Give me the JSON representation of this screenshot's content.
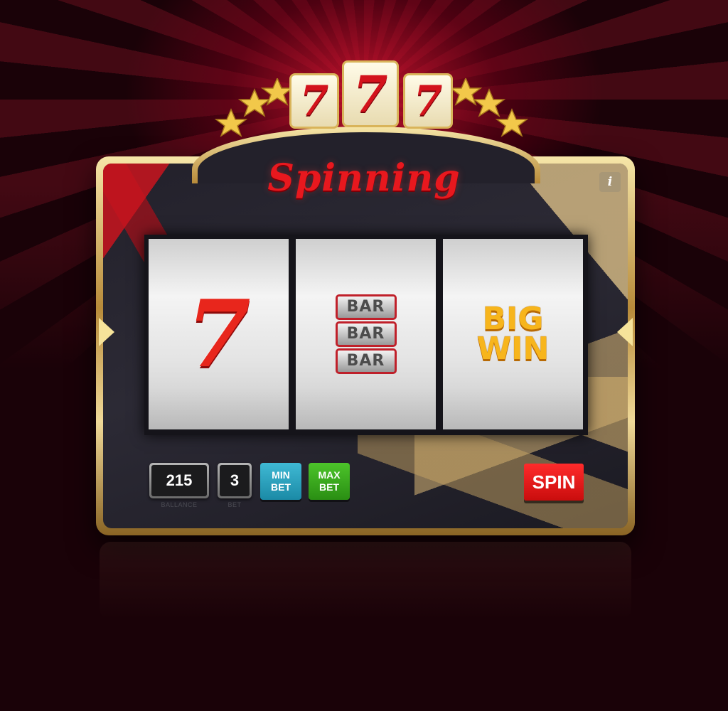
{
  "header": {
    "logo_digits": [
      "7",
      "7",
      "7"
    ],
    "title": "Spinning",
    "info_label": "i"
  },
  "reels": [
    {
      "symbol": "seven",
      "text": "7"
    },
    {
      "symbol": "triple-bar",
      "text": [
        "BAR",
        "BAR",
        "BAR"
      ]
    },
    {
      "symbol": "big-win",
      "text": [
        "BIG",
        "WIN"
      ]
    }
  ],
  "controls": {
    "balance_value": "215",
    "balance_label": "BALLANCE",
    "bet_value": "3",
    "bet_label": "BET",
    "min_bet_label": [
      "MIN",
      "BET"
    ],
    "max_bet_label": [
      "MAX",
      "BET"
    ],
    "spin_label": "SPIN"
  },
  "icons": {
    "info": "info-icon",
    "left_arrow": "left-arrow-icon",
    "right_arrow": "right-arrow-icon",
    "stars": "star-icon"
  },
  "colors": {
    "accent_red": "#e8181e",
    "gold": "#d9b45a",
    "min_bet_blue": "#2aa3c0",
    "max_bet_green": "#38a91e",
    "spin_red": "#f01818"
  }
}
